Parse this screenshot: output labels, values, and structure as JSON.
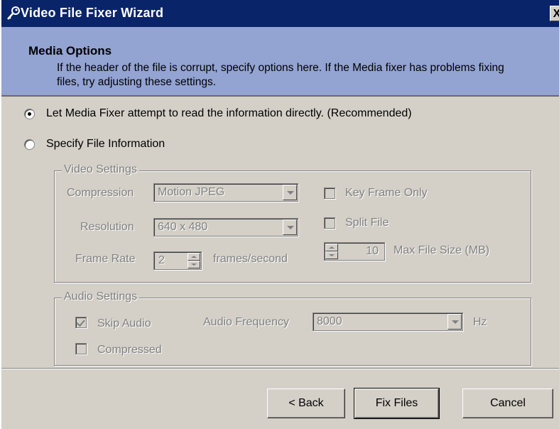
{
  "window": {
    "title": "Video File Fixer Wizard",
    "close_label": "X",
    "title_icon": "key-icon"
  },
  "header": {
    "title": "Media Options",
    "description": "If the header of the file is corrupt, specify options here.  If the Media fixer has problems fixing files, try adjusting these settings."
  },
  "options": {
    "auto_label": "Let Media Fixer attempt to read the information directly. (Recommended)",
    "auto_selected": true,
    "specify_label": "Specify File Information",
    "specify_selected": false
  },
  "video_settings": {
    "legend": "Video Settings",
    "compression_label": "Compression",
    "compression_value": "Motion JPEG",
    "resolution_label": "Resolution",
    "resolution_value": "640 x 480",
    "frame_rate_label": "Frame Rate",
    "frame_rate_value": "2",
    "frame_rate_unit": "frames/second",
    "key_frame_label": "Key Frame Only",
    "key_frame_checked": false,
    "split_file_label": "Split File",
    "split_file_checked": false,
    "max_file_size_value": "10",
    "max_file_size_label": "Max File Size (MB)"
  },
  "audio_settings": {
    "legend": "Audio Settings",
    "skip_audio_label": "Skip Audio",
    "skip_audio_checked": true,
    "frequency_label": "Audio Frequency",
    "frequency_value": "8000",
    "frequency_unit": "Hz",
    "compressed_label": "Compressed",
    "compressed_checked": false
  },
  "buttons": {
    "back": "< Back",
    "fix": "Fix Files",
    "cancel": "Cancel"
  },
  "colors": {
    "titlebar": "#0a246a",
    "header_band": "#93a3d2",
    "face": "#d4d0c8",
    "disabled_text": "#808080"
  }
}
